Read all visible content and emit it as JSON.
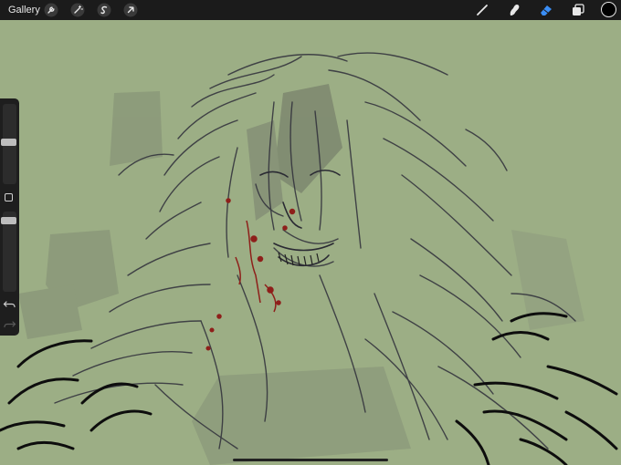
{
  "app": {
    "gallery_label": "Gallery"
  },
  "toolbar_left": {
    "icons": [
      "wrench-icon",
      "magic-wand-icon",
      "selection-icon",
      "transform-arrow-icon"
    ]
  },
  "toolbar_right": {
    "icons": [
      "brush-icon",
      "smudge-icon",
      "eraser-icon",
      "layers-icon",
      "color-swatch"
    ],
    "active_tool": "eraser",
    "active_color": "#000000",
    "accent": "#3a8ef6"
  },
  "sidebar": {
    "brush_size": 0.62,
    "opacity": 0.85,
    "controls": [
      "brush-size-slider",
      "modify-button",
      "opacity-slider",
      "undo-icon",
      "redo-icon"
    ]
  },
  "canvas": {
    "background": "#9cae85"
  }
}
